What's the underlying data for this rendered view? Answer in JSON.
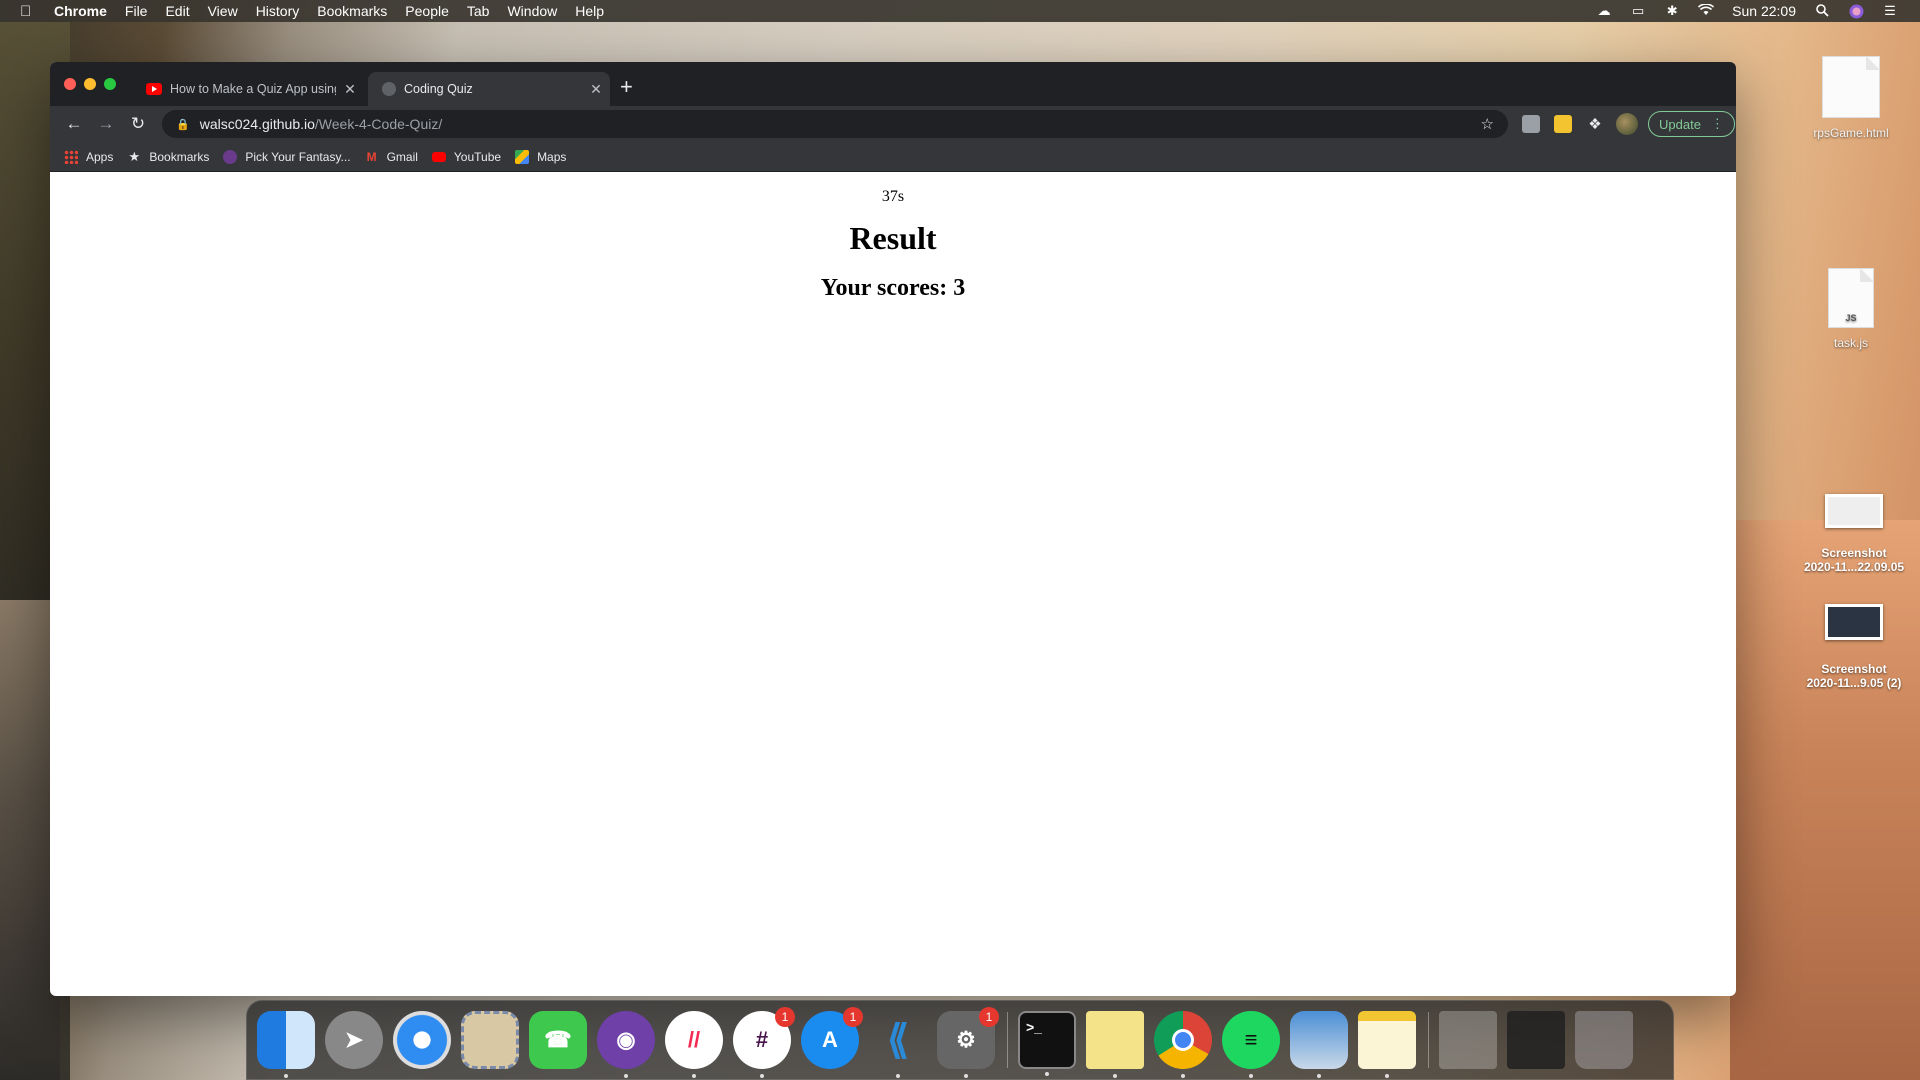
{
  "menubar": {
    "app_name": "Chrome",
    "menus": [
      "File",
      "Edit",
      "View",
      "History",
      "Bookmarks",
      "People",
      "Tab",
      "Window",
      "Help"
    ],
    "clock": "Sun 22:09"
  },
  "browser": {
    "tabs": [
      {
        "title": "How to Make a Quiz App using",
        "favicon": "youtube-icon"
      },
      {
        "title": "Coding Quiz",
        "favicon": "globe-icon"
      }
    ],
    "url_host": "walsc024.github.io",
    "url_path": "/Week-4-Code-Quiz/",
    "update_label": "Update",
    "bookmarks": [
      {
        "label": "Apps",
        "icon": "apps-grid-icon"
      },
      {
        "label": "Bookmarks",
        "icon": "star-icon"
      },
      {
        "label": "Pick Your Fantasy...",
        "icon": "fantasy-icon"
      },
      {
        "label": "Gmail",
        "icon": "gmail-icon"
      },
      {
        "label": "YouTube",
        "icon": "youtube-icon"
      },
      {
        "label": "Maps",
        "icon": "maps-icon"
      }
    ]
  },
  "page": {
    "timer": "37s",
    "title": "Result",
    "score_text": "Your scores: 3"
  },
  "desktop": {
    "items": [
      {
        "label": "rpsGame.html"
      },
      {
        "label": "task.js",
        "glyph": "JS"
      },
      {
        "label_line1": "Screenshot",
        "label_line2": "2020-11...22.09.05"
      },
      {
        "label_line1": "Screenshot",
        "label_line2": "2020-11...9.05 (2)"
      }
    ]
  },
  "dock": {
    "apps": [
      {
        "name": "Finder",
        "icon": "finder-icon"
      },
      {
        "name": "Launchpad",
        "icon": "rocket-icon"
      },
      {
        "name": "Safari",
        "icon": "compass-icon"
      },
      {
        "name": "Mail",
        "icon": "mail-stamp-icon"
      },
      {
        "name": "FaceTime",
        "icon": "facetime-icon"
      },
      {
        "name": "GitHub Desktop",
        "icon": "github-icon"
      },
      {
        "name": "monday.com",
        "icon": "monday-icon"
      },
      {
        "name": "Slack",
        "icon": "slack-icon",
        "badge": "1"
      },
      {
        "name": "App Store",
        "icon": "app-store-icon",
        "badge": "1"
      },
      {
        "name": "Visual Studio Code",
        "icon": "vscode-icon"
      },
      {
        "name": "System Preferences",
        "icon": "gear-icon",
        "badge": "1"
      },
      {
        "name": "Terminal",
        "icon": "terminal-icon",
        "glyph": ">_"
      },
      {
        "name": "Stickies",
        "icon": "stickies-icon"
      },
      {
        "name": "Google Chrome",
        "icon": "chrome-icon"
      },
      {
        "name": "Spotify",
        "icon": "spotify-icon"
      },
      {
        "name": "Preview",
        "icon": "preview-icon"
      },
      {
        "name": "Notes",
        "icon": "notes-icon"
      }
    ]
  }
}
